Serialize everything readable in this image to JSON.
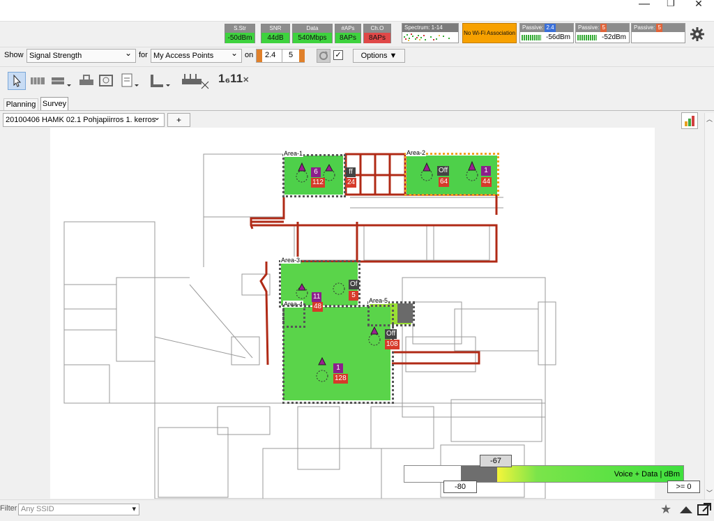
{
  "window": {
    "minimize": "—",
    "maximize": "❐",
    "close": "✕"
  },
  "status": [
    {
      "label": "S.Str",
      "value": "-50dBm",
      "color": "#3ed23e"
    },
    {
      "label": "SNR",
      "value": "44dB",
      "color": "#3ed23e"
    },
    {
      "label": "Data",
      "value": "540Mbps",
      "color": "#3ed23e"
    },
    {
      "label": "#APs",
      "value": "8APs",
      "color": "#3ed23e"
    },
    {
      "label": "Ch.O",
      "value": "8APs",
      "color": "#e04848"
    }
  ],
  "spectrum_label": "Spectrum: 1-14",
  "no_wifi": "No Wi-Fi Association",
  "passive": [
    {
      "label": "Passive:",
      "band": "2.4",
      "band_color": "#3a6fd8",
      "dbm": "-56dBm"
    },
    {
      "label": "Passive:",
      "band": "5",
      "band_color": "#e0643a",
      "dbm": "-52dBm"
    },
    {
      "label": "Passive:",
      "band": "5",
      "band_color": "#e0643a",
      "dbm": ""
    }
  ],
  "toolbar": {
    "show_label": "Show",
    "show_value": "Signal Strength",
    "for_label": "for",
    "for_value": "My Access Points",
    "on_label": "on",
    "band1": "2.4",
    "band2": "5",
    "options_label": "Options ▼"
  },
  "tabs": [
    "Planning",
    "Survey"
  ],
  "floor_select": "20100406 HAMK 02.1 Pohjapiirros 1. kerros",
  "add_button": "+",
  "areas": [
    {
      "label": "Area-1"
    },
    {
      "label": "Area-2"
    },
    {
      "label": "Area-3"
    },
    {
      "label": "Area-4"
    },
    {
      "label": "Area-5"
    }
  ],
  "badges": {
    "a1_ch": "6",
    "a1_val": "112",
    "a1_off": "ff",
    "a1_val2": "24",
    "a2_off": "Off",
    "a2_val": "64",
    "a2_ch": "1",
    "a2_val2": "44",
    "a3_ch": "11",
    "a3_off": "Of",
    "a3_val": "5",
    "a4_val": "48",
    "a5_off": "Off",
    "a5_val": "108",
    "big_ch": "1",
    "big_val": "128"
  },
  "legend": {
    "label": "Voice + Data | dBm",
    "threshold_top": "-67",
    "threshold_low": "-80",
    "threshold_high": ">= 0"
  },
  "tool_label_16": "1₆11",
  "filter_label": "Filter",
  "ssid_placeholder": "Any SSID"
}
